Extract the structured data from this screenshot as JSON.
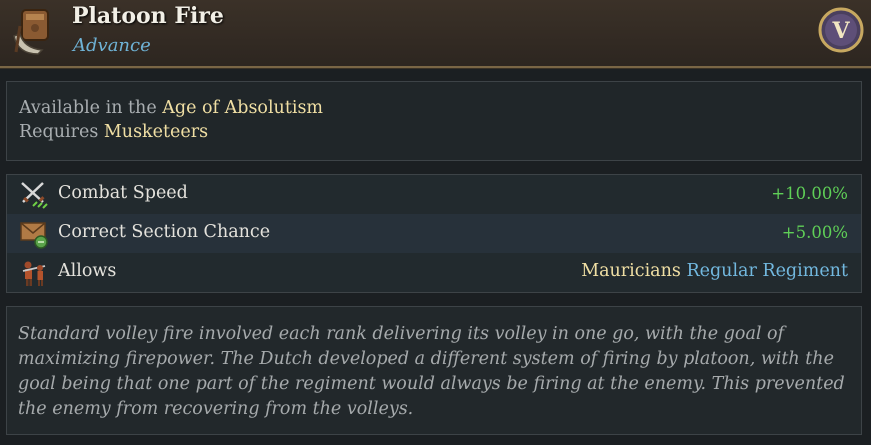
{
  "header": {
    "title": "Platoon Fire",
    "subtitle": "Advance",
    "icon": "musketeer-equipment-icon",
    "era_badge": "V"
  },
  "info": {
    "available_prefix": "Available in the",
    "age": "Age of Absolutism",
    "requires_prefix": "Requires",
    "requirement": "Musketeers"
  },
  "stats": [
    {
      "icon": "crossed-swords-speed-icon",
      "label": "Combat Speed",
      "value": "+10.00%"
    },
    {
      "icon": "section-chance-icon",
      "label": "Correct Section Chance",
      "value": "+5.00%"
    },
    {
      "icon": "musketeer-unit-icon",
      "label": "Allows",
      "civ": "Mauricians",
      "unit": "Regular Regiment"
    }
  ],
  "description": "Standard volley fire involved each rank delivering its volley in one go, with the goal of maximizing firepower. The Dutch developed a different system of firing by platoon, with the goal being that one part of the regiment would always be firing at the enemy. This prevented the enemy from recovering from the volleys.",
  "colors": {
    "positive": "#5fcf57",
    "highlight": "#f0dfa4",
    "link": "#72b8df",
    "header_border": "#7a6645"
  }
}
